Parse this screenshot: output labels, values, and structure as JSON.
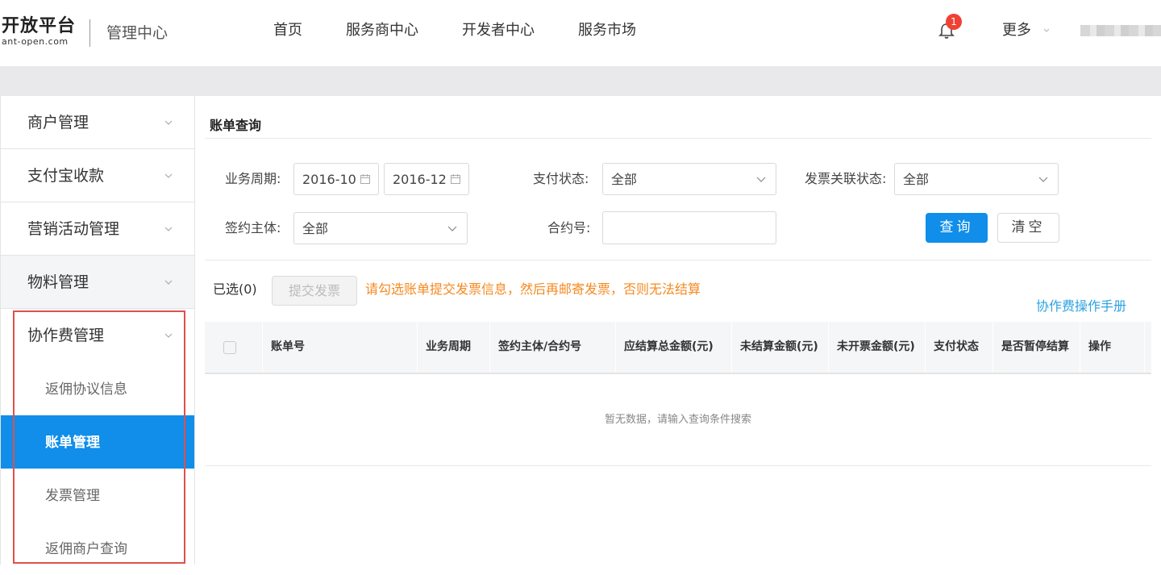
{
  "header": {
    "logo_main": "开放平台",
    "logo_sub": "ant-open.com",
    "center_title": "管理中心",
    "nav": [
      {
        "label": "首页"
      },
      {
        "label": "服务商中心"
      },
      {
        "label": "开发者中心"
      },
      {
        "label": "服务市场"
      }
    ],
    "notification_count": "1",
    "more_label": "更多"
  },
  "sidebar": {
    "items": [
      {
        "label": "商户管理"
      },
      {
        "label": "支付宝收款"
      },
      {
        "label": "营销活动管理"
      },
      {
        "label": "物料管理"
      },
      {
        "label": "协作费管理"
      }
    ],
    "sub_items": [
      {
        "label": "返佣协议信息"
      },
      {
        "label": "账单管理"
      },
      {
        "label": "发票管理"
      },
      {
        "label": "返佣商户查询"
      }
    ]
  },
  "main": {
    "title": "账单查询",
    "form": {
      "period_label": "业务周期:",
      "period_start": "2016-10",
      "period_end": "2016-12",
      "pay_status_label": "支付状态:",
      "pay_status_value": "全部",
      "invoice_status_label": "发票关联状态:",
      "invoice_status_value": "全部",
      "contract_entity_label": "签约主体:",
      "contract_entity_value": "全部",
      "contract_no_label": "合约号:",
      "contract_no_value": "",
      "query_button": "查询",
      "clear_button": "清空"
    },
    "selected_count": "已选(0)",
    "submit_invoice_button": "提交发票",
    "warning": "请勾选账单提交发票信息，然后再邮寄发票，否则无法结算",
    "manual_link": "协作费操作手册",
    "table": {
      "headers": [
        "账单号",
        "业务周期",
        "签约主体/合约号",
        "应结算总金额(元)",
        "未结算金额(元)",
        "未开票金额(元)",
        "支付状态",
        "是否暂停结算",
        "操作"
      ],
      "empty_text": "暂无数据，请输入查询条件搜索"
    }
  },
  "colors": {
    "primary": "#108ee9",
    "warning": "#f5891f",
    "link": "#2ba2e0",
    "badge": "#f04134",
    "highlight_box": "#e0504b"
  }
}
